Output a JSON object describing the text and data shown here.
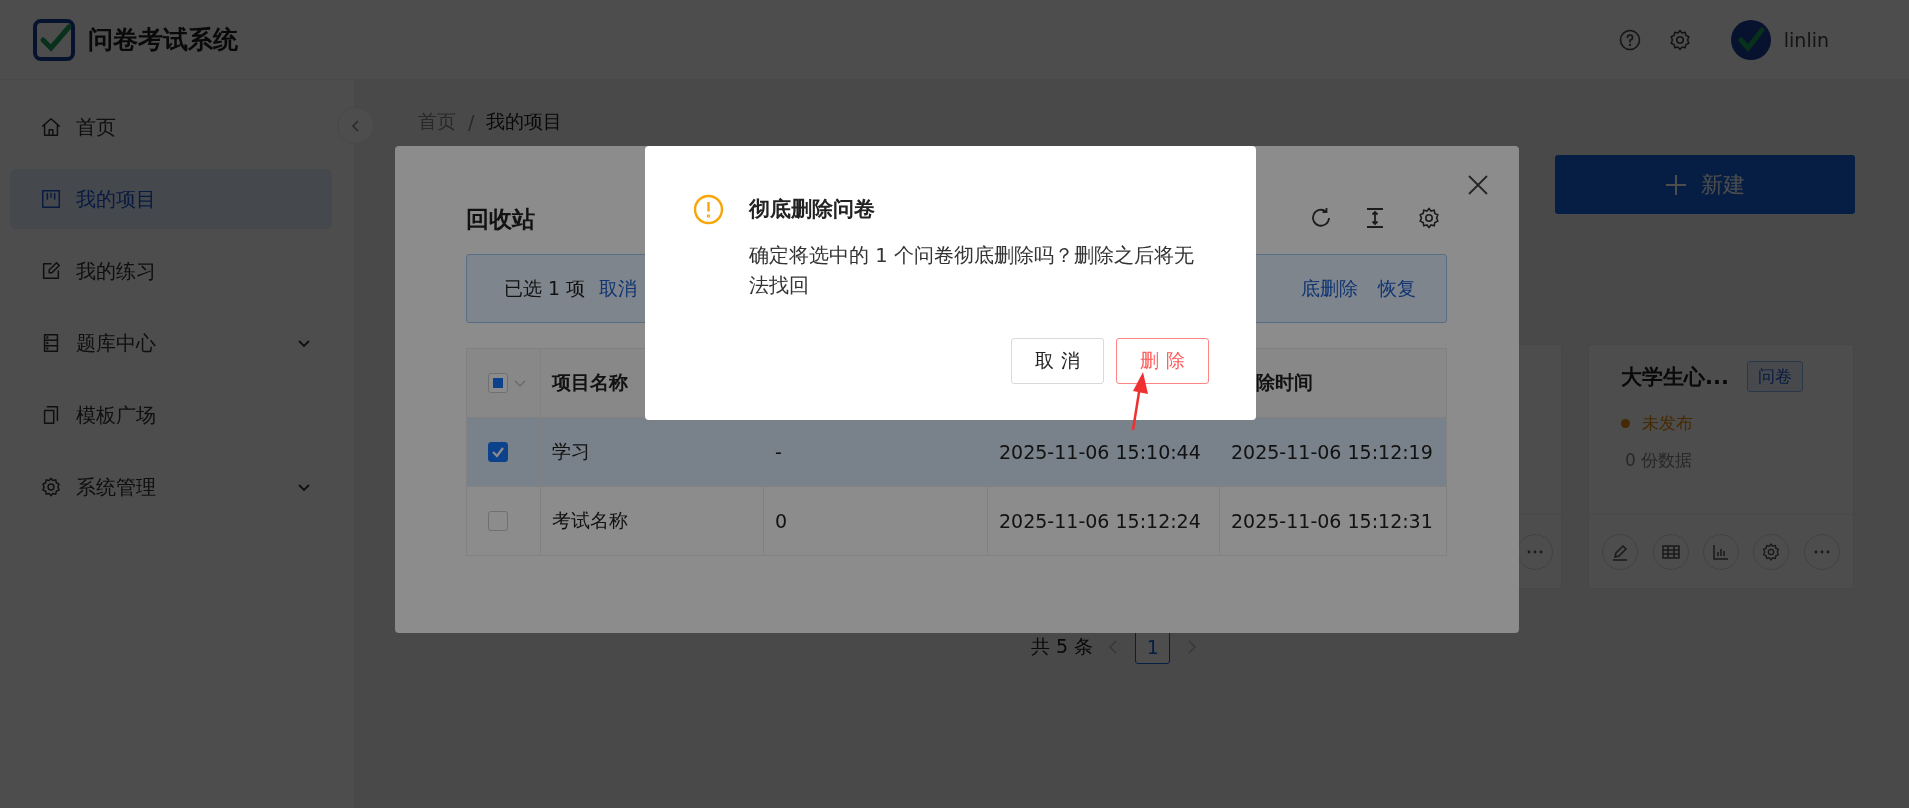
{
  "header": {
    "app_title": "问卷考试系统",
    "user_name": "linlin"
  },
  "sidebar": {
    "items": [
      {
        "label": "首页",
        "kind": "home",
        "selected": false,
        "has_submenu": false
      },
      {
        "label": "我的项目",
        "kind": "board",
        "selected": true,
        "has_submenu": false
      },
      {
        "label": "我的练习",
        "kind": "edit",
        "selected": false,
        "has_submenu": false
      },
      {
        "label": "题库中心",
        "kind": "bank",
        "selected": false,
        "has_submenu": true
      },
      {
        "label": "模板广场",
        "kind": "copy",
        "selected": false,
        "has_submenu": false
      },
      {
        "label": "系统管理",
        "kind": "gear",
        "selected": false,
        "has_submenu": true
      }
    ]
  },
  "breadcrumb": {
    "items": [
      "首页",
      "我的项目"
    ],
    "separator": "/"
  },
  "new_button": {
    "label": "新建"
  },
  "cards": [
    {
      "title": "大学生心...",
      "tag": "问卷",
      "status": "未发布",
      "count": "0 份数据"
    }
  ],
  "pagination": {
    "total": "共 5 条",
    "pages": [
      {
        "label": "1",
        "selected": true
      }
    ]
  },
  "recycle_bin": {
    "title": "回收站",
    "selection_text": "已选 1 项",
    "clear_link": "取消",
    "delete_link": "底删除",
    "restore_link": "恢复",
    "table": {
      "partially_checked": true,
      "header": {
        "column_2": "项目名称",
        "column_5": "除时间"
      },
      "rows": [
        {
          "selected": true,
          "cells": [
            "学习",
            "-",
            "2025-11-06 15:10:44",
            "2025-11-06 15:12:19"
          ]
        },
        {
          "selected": false,
          "cells": [
            "考试名称",
            "0",
            "2025-11-06 15:12:24",
            "2025-11-06 15:12:31"
          ]
        }
      ]
    }
  },
  "dialog": {
    "title": "彻底删除问卷",
    "message": "确定将选中的 1 个问卷彻底删除吗？删除之后将无法找回",
    "buttons": [
      {
        "label": "取 消",
        "kind": "default"
      },
      {
        "label": "删 除",
        "kind": "danger"
      }
    ]
  }
}
